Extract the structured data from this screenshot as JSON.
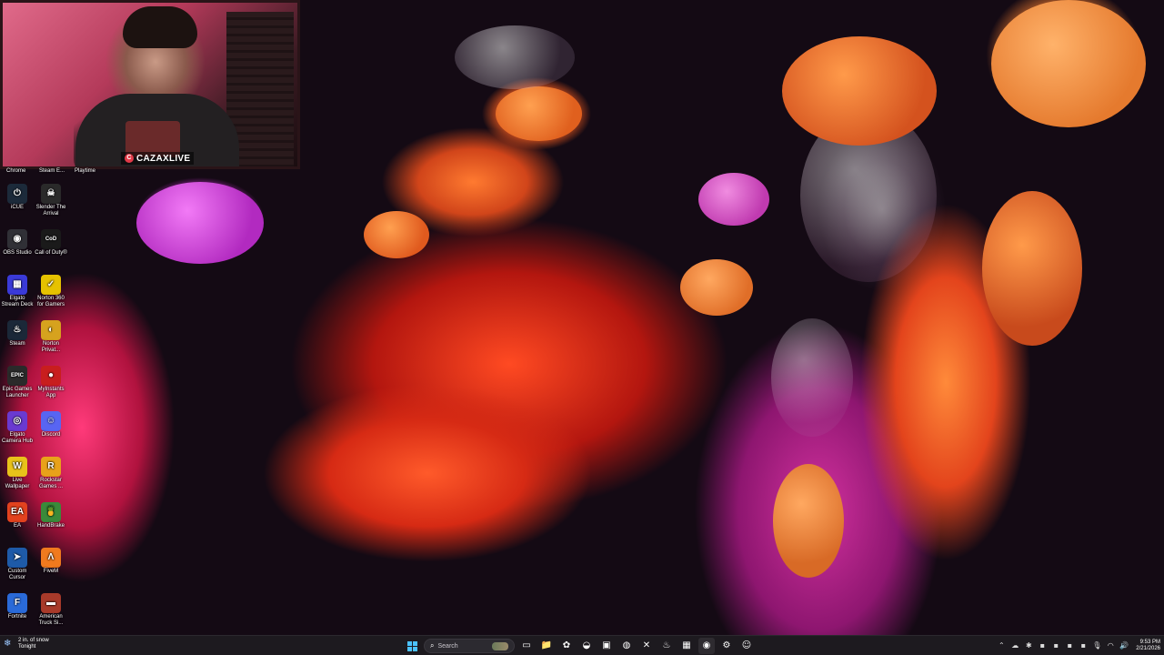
{
  "webcam": {
    "brand_text": "CAZAXLIVE",
    "brand_logo": "C"
  },
  "desktop": {
    "top_labels": [
      "Chrome",
      "Steam E...",
      "Playtime"
    ],
    "icons": [
      {
        "label": "iCUE",
        "icon": "icue-icon",
        "glyph": "⏻",
        "color": "#1c2a3a"
      },
      {
        "label": "Slender The Arrival",
        "icon": "slender-icon",
        "glyph": "☠",
        "color": "#2a2a2a"
      },
      {
        "label": "OBS Studio",
        "icon": "obs-icon",
        "glyph": "◉",
        "color": "#303036"
      },
      {
        "label": "Call of Duty®",
        "icon": "call-of-duty-icon",
        "glyph": "CoD",
        "color": "#1a1a1a"
      },
      {
        "label": "Elgato Stream Deck",
        "icon": "stream-deck-icon",
        "glyph": "▦",
        "color": "#3a3ad8"
      },
      {
        "label": "Norton 360 for Gamers",
        "icon": "norton-icon",
        "glyph": "✓",
        "color": "#e6c200"
      },
      {
        "label": "Steam",
        "icon": "steam-icon",
        "glyph": "♨",
        "color": "#1b2838"
      },
      {
        "label": "Norton Privat...",
        "icon": "norton-private-icon",
        "glyph": "◐",
        "color": "#d6a21e"
      },
      {
        "label": "Epic Games Launcher",
        "icon": "epic-games-icon",
        "glyph": "EPIC",
        "color": "#2a2a2a"
      },
      {
        "label": "MyInstants App",
        "icon": "myinstants-icon",
        "glyph": "●",
        "color": "#c81e1e"
      },
      {
        "label": "Elgato Camera Hub",
        "icon": "camera-hub-icon",
        "glyph": "◎",
        "color": "#6a3ad0"
      },
      {
        "label": "Discord",
        "icon": "discord-icon",
        "glyph": "☺",
        "color": "#5865f2"
      },
      {
        "label": "Live Wallpaper",
        "icon": "live-wallpaper-icon",
        "glyph": "W",
        "color": "#e8c21a"
      },
      {
        "label": "Rockstar Games ...",
        "icon": "rockstar-icon",
        "glyph": "R",
        "color": "#e8a21a"
      },
      {
        "label": "EA",
        "icon": "ea-icon",
        "glyph": "EA",
        "color": "#e2421e"
      },
      {
        "label": "HandBrake",
        "icon": "handbrake-icon",
        "glyph": "🍍",
        "color": "#3a8a3a"
      },
      {
        "label": "Custom Cursor",
        "icon": "custom-cursor-icon",
        "glyph": "➤",
        "color": "#1e5aa8"
      },
      {
        "label": "FiveM",
        "icon": "fivem-icon",
        "glyph": "Λ",
        "color": "#f07a1e"
      },
      {
        "label": "Fortnite",
        "icon": "fortnite-icon",
        "glyph": "F",
        "color": "#2a6ad8"
      },
      {
        "label": "American Truck Si...",
        "icon": "american-truck-icon",
        "glyph": "▬",
        "color": "#a83a2a"
      }
    ]
  },
  "taskbar": {
    "weather_line1": "2 in. of snow",
    "weather_line2": "Tonight",
    "search_placeholder": "Search",
    "clock_time": "9:53 PM",
    "clock_date": "2/21/2026",
    "apps": [
      {
        "name": "task-view-icon",
        "glyph": "▭"
      },
      {
        "name": "file-explorer-icon",
        "glyph": "📁"
      },
      {
        "name": "copilot-icon",
        "glyph": "✿"
      },
      {
        "name": "edge-icon",
        "glyph": "◒"
      },
      {
        "name": "store-icon",
        "glyph": "▣"
      },
      {
        "name": "chrome-icon",
        "glyph": "◍"
      },
      {
        "name": "xbox-icon",
        "glyph": "✕"
      },
      {
        "name": "steam-taskbar-icon",
        "glyph": "♨"
      },
      {
        "name": "stream-deck-taskbar-icon",
        "glyph": "▦"
      },
      {
        "name": "obs-taskbar-icon",
        "glyph": "◉"
      },
      {
        "name": "settings-icon",
        "glyph": "⚙"
      },
      {
        "name": "discord-taskbar-icon",
        "glyph": "☺"
      }
    ],
    "tray": [
      {
        "name": "show-hidden-icons-chevron-icon",
        "glyph": "⌃"
      },
      {
        "name": "cloud-tray-icon",
        "glyph": "☁"
      },
      {
        "name": "bluetooth-tray-icon",
        "glyph": "✱"
      },
      {
        "name": "app-tray-icon-1",
        "glyph": "▪"
      },
      {
        "name": "app-tray-icon-2",
        "glyph": "▪"
      },
      {
        "name": "app-tray-icon-3",
        "glyph": "▪"
      },
      {
        "name": "app-tray-icon-4",
        "glyph": "▪"
      },
      {
        "name": "microphone-tray-icon",
        "glyph": "🎙"
      },
      {
        "name": "wifi-icon",
        "glyph": "◠"
      },
      {
        "name": "volume-icon",
        "glyph": "🔊"
      }
    ]
  }
}
